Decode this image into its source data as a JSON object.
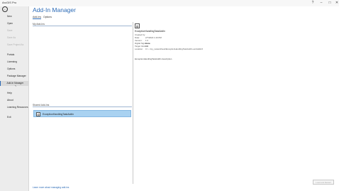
{
  "window": {
    "app_title": "ArcGIS Pro",
    "help": "?",
    "minimize": "–",
    "maximize": "□",
    "close": "✕"
  },
  "sidebar": {
    "back_glyph": "←",
    "items": [
      {
        "label": "New",
        "state": "normal"
      },
      {
        "label": "Open",
        "state": "normal"
      },
      {
        "label": "Save",
        "state": "disabled"
      },
      {
        "label": "Save As",
        "state": "disabled"
      },
      {
        "label": "Save Project As",
        "state": "disabled"
      },
      {
        "label": "Portals",
        "state": "normal"
      },
      {
        "label": "Licensing",
        "state": "normal"
      },
      {
        "label": "Options",
        "state": "normal"
      },
      {
        "label": "Package Manager",
        "state": "normal"
      },
      {
        "label": "Add-In Manager",
        "state": "selected"
      },
      {
        "label": "Help",
        "state": "normal"
      },
      {
        "label": "About",
        "state": "normal"
      },
      {
        "label": "Learning Resources",
        "state": "normal"
      },
      {
        "label": "Exit",
        "state": "normal"
      }
    ]
  },
  "main": {
    "title": "Add-In Manager",
    "tabs": [
      {
        "label": "Add-Ins",
        "active": true
      },
      {
        "label": "Options",
        "active": false
      }
    ],
    "my_addins": {
      "header": "My Add-Ins"
    },
    "shared_addins": {
      "header": "Shared Add-Ins",
      "items": [
        {
          "name": "ExceptionHandlingTaskAddIn",
          "icon": "addin-icon"
        }
      ]
    },
    "details": {
      "icon": "addin-icon",
      "name": "ExceptionHandlingTaskAddIn",
      "fields": [
        {
          "label": "Created by:",
          "value": ""
        },
        {
          "label": "Date:",
          "value": "2/7/2022 1:20 PM"
        },
        {
          "label": "Version:",
          "value": "1.0"
        },
        {
          "label": "Digital Signature:",
          "value": "None"
        },
        {
          "label": "Target Version:",
          "value": "3.0"
        },
        {
          "label": "Location:",
          "value": "C:\\...\\my_network\\test\\ExceptionHandlingTaskAddIn.esriAddinX"
        }
      ],
      "description": "ExceptionHandlingTaskAddIn description"
    },
    "footer_link": "Learn more about managing add-ins",
    "action_button": "Load and Restart"
  },
  "colors": {
    "accent": "#2b6ab6",
    "selection": "#a9d2f1"
  }
}
